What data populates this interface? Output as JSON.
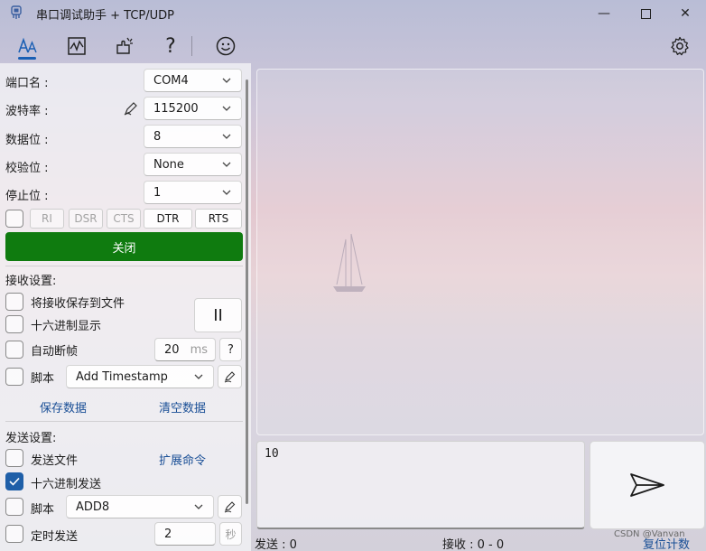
{
  "window": {
    "title": "串口调试助手 + TCP/UDP",
    "minimize_symbol": "—",
    "maximize_symbol": "☐",
    "close_symbol": "✕"
  },
  "toolbar": {
    "tabs": [
      {
        "icon": "font-settings-icon",
        "active": true
      },
      {
        "icon": "waveform-chart-icon",
        "active": false
      },
      {
        "icon": "plugin-icon",
        "active": false
      },
      {
        "icon": "help-icon",
        "active": false
      },
      {
        "icon": "smiley-icon",
        "active": false
      }
    ],
    "settings_icon": "gear-icon"
  },
  "serial": {
    "port_label": "端口名 :",
    "port_value": "COM4",
    "baud_label": "波特率 :",
    "baud_value": "115200",
    "databits_label": "数据位 :",
    "databits_value": "8",
    "parity_label": "校验位 :",
    "parity_value": "None",
    "stopbits_label": "停止位 :",
    "stopbits_value": "1",
    "signals": {
      "ri": "RI",
      "dsr": "DSR",
      "cts": "CTS",
      "dtr": "DTR",
      "rts": "RTS"
    },
    "close_label": "关闭"
  },
  "receive": {
    "section_label": "接收设置:",
    "save_to_file": "将接收保存到文件",
    "hex_display": "十六进制显示",
    "auto_frame": "自动断帧",
    "frame_ms_value": "20",
    "frame_ms_unit": "ms",
    "help_label": "?",
    "pause_label": "II",
    "script_label": "脚本",
    "script_value": "Add Timestamp",
    "save_data": "保存数据",
    "clear_data": "清空数据"
  },
  "send": {
    "section_label": "发送设置:",
    "send_file": "发送文件",
    "extend_cmd": "扩展命令",
    "hex_send": "十六进制发送",
    "hex_send_checked": true,
    "script_label": "脚本",
    "script_value": "ADD8",
    "timed_send": "定时发送",
    "timed_value": "2",
    "timed_unit": "秒",
    "input_value": "10"
  },
  "status": {
    "sent_label": "发送 : 0",
    "received_label": "接收 : 0 - 0",
    "reset_counter": "复位计数",
    "watermark": "CSDN @Vanvan"
  },
  "colors": {
    "accent": "#1f5fa8",
    "close_button": "#0f7b0f",
    "link": "#1a4f96"
  }
}
